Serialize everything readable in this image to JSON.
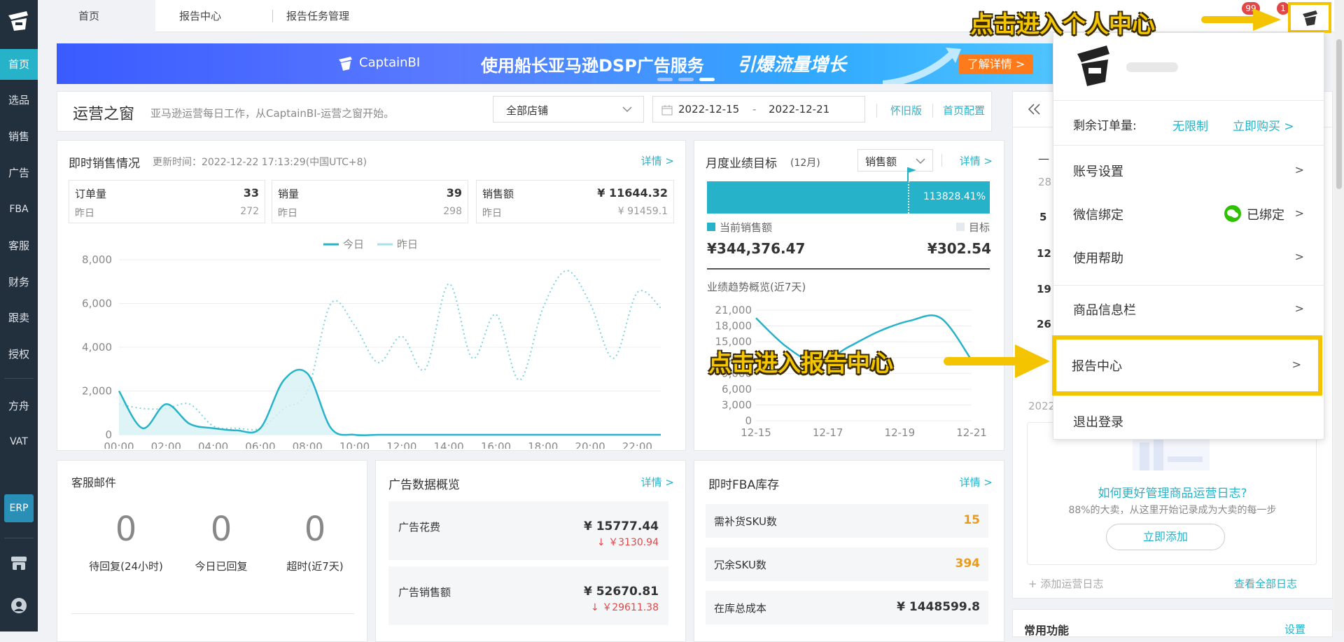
{
  "sidebar": {
    "items": [
      "首页",
      "选品",
      "销售",
      "广告",
      "FBA",
      "客服",
      "财务",
      "跟卖",
      "授权",
      "方舟",
      "VAT"
    ],
    "erp": "ERP"
  },
  "topbar": {
    "tabs": [
      "首页",
      "报告中心",
      "报告任务管理"
    ],
    "badge_msgs": "99",
    "badge_notice": "1"
  },
  "banner": {
    "brand": "CaptainBI",
    "text": "使用船长亚马逊DSP广告服务",
    "slogan": "引爆流量增长",
    "cta": "了解详情 >"
  },
  "ops": {
    "title": "运营之窗",
    "subtitle": "亚马逊运营每日工作，从CaptainBI-运营之窗开始。",
    "store": "全部店铺",
    "date_from": "2022-12-15",
    "date_sep": "-",
    "date_to": "2022-12-21",
    "old_version": "怀旧版",
    "config": "首页配置"
  },
  "sales": {
    "title": "即时销售情况",
    "updated": "更新时间：2022-12-22 17:13:29(中国UTC+8)",
    "detail": "详情 >",
    "stats": [
      {
        "label": "订单量",
        "value": "33",
        "prev_label": "昨日",
        "prev": "272"
      },
      {
        "label": "销量",
        "value": "39",
        "prev_label": "昨日",
        "prev": "298"
      },
      {
        "label": "销售额",
        "value": "¥  11644.32",
        "prev_label": "昨日",
        "prev": "¥ 91459.1"
      }
    ],
    "legend_today": "今日",
    "legend_yesterday": "昨日"
  },
  "chart_data": [
    {
      "type": "line",
      "series": [
        {
          "name": "今日",
          "values": [
            2000,
            300,
            1400,
            500,
            300,
            200,
            300,
            2500,
            2800,
            300,
            0,
            0,
            0,
            0,
            0,
            0,
            0,
            0,
            0,
            0,
            0,
            0,
            0,
            0
          ]
        },
        {
          "name": "昨日",
          "values": [
            1400,
            1200,
            1200,
            1400,
            400,
            300,
            300,
            1200,
            2000,
            6000,
            5000,
            3300,
            4500,
            3000,
            6900,
            3500,
            5500,
            2500,
            5800,
            7500,
            6000,
            3500,
            6500,
            5800
          ]
        }
      ],
      "x": [
        "00:00",
        "01:00",
        "02:00",
        "03:00",
        "04:00",
        "05:00",
        "06:00",
        "07:00",
        "08:00",
        "09:00",
        "10:00",
        "11:00",
        "12:00",
        "13:00",
        "14:00",
        "15:00",
        "16:00",
        "17:00",
        "18:00",
        "19:00",
        "20:00",
        "21:00",
        "22:00",
        "23:00"
      ],
      "xticks": [
        "00:00",
        "02:00",
        "04:00",
        "06:00",
        "08:00",
        "10:00",
        "12:00",
        "14:00",
        "16:00",
        "18:00",
        "20:00",
        "22:00"
      ],
      "yticks": [
        "0",
        "2,000",
        "4,000",
        "6,000",
        "8,000"
      ],
      "ylim": [
        0,
        8000
      ],
      "grid": true,
      "legend": "top-center",
      "colors": {
        "today": "#26b3c9",
        "yesterday": "#7fd2e0"
      }
    },
    {
      "type": "line",
      "series": [
        {
          "values": [
            19500,
            14000,
            11000,
            14000,
            17000,
            19000,
            19500,
            11500
          ]
        }
      ],
      "x": [
        "12-15",
        "12-16",
        "12-17",
        "12-18",
        "12-19",
        "12-20",
        "12-21"
      ],
      "xticks": [
        "12-15",
        "12-17",
        "12-19",
        "12-21"
      ],
      "yticks": [
        "0",
        "3,000",
        "6,000",
        "9,000",
        "12,000",
        "15,000",
        "18,000",
        "21,000"
      ],
      "ylim": [
        0,
        21000
      ],
      "grid": true
    }
  ],
  "monthly": {
    "title": "月度业绩目标",
    "month": "(12月)",
    "select": "销售额",
    "detail": "详情 >",
    "progress_label": "113828.41%",
    "progress": 100,
    "current_label": "当前销售额",
    "target_label": "目标",
    "current": "¥344,376.47",
    "target": "¥302.54",
    "trend_title": "业绩趋势概览(近7天)"
  },
  "cs": {
    "title": "客服邮件",
    "items": [
      {
        "value": "0",
        "label": "待回复(24小时)"
      },
      {
        "value": "0",
        "label": "今日已回复"
      },
      {
        "value": "0",
        "label": "超时(近7天)"
      }
    ]
  },
  "ads": {
    "title": "广告数据概览",
    "detail": "详情 >",
    "rows": [
      {
        "label": "广告花费",
        "value": "¥ 15777.44",
        "delta": "↓ ￥3130.94"
      },
      {
        "label": "广告销售额",
        "value": "¥ 52670.81",
        "delta": "↓ ￥29611.38"
      }
    ]
  },
  "fba": {
    "title": "即时FBA库存",
    "detail": "详情 >",
    "rows": [
      {
        "label": "需补货SKU数",
        "value": "15"
      },
      {
        "label": "冗余SKU数",
        "value": "394"
      },
      {
        "label": "在库总成本",
        "value": "¥ 1448599.8"
      }
    ]
  },
  "right_panel": {
    "dates": [
      "28",
      "5",
      "12",
      "19",
      "26"
    ],
    "year": "2022",
    "promo_title": "如何更好管理商品运营日志?",
    "promo_sub": "88%的大卖，从这里开始记录成为大卖的每一步",
    "promo_btn": "立即添加",
    "add_log": "+ 添加运营日志",
    "all_logs": "查看全部日志",
    "common": "常用功能",
    "settings": "设置"
  },
  "menu": {
    "remaining_label": "剩余订单量:",
    "remaining_value": "无限制",
    "buy": "立即购买 >",
    "items": [
      {
        "label": "账号设置",
        "arrow": ">"
      },
      {
        "label": "微信绑定",
        "status": "已绑定",
        "arrow": ">"
      },
      {
        "label": "使用帮助",
        "arrow": ">"
      },
      {
        "label": "商品信息栏",
        "arrow": ">"
      },
      {
        "label": "报告中心",
        "arrow": ">"
      },
      {
        "label": "退出登录"
      }
    ]
  },
  "annotations": {
    "top": "点击进入个人中心",
    "mid": "点击进入报告中心"
  },
  "colors": {
    "accent": "#26b3c9",
    "sidebar": "#22303d",
    "highlight": "#f5c400",
    "orange": "#e89b1c",
    "red": "#e04848"
  }
}
